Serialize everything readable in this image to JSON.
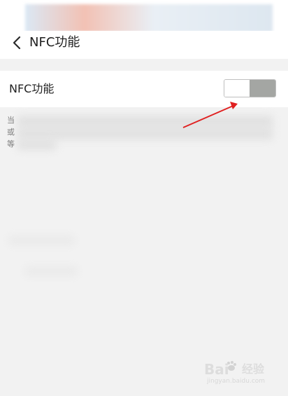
{
  "status": {
    "blurred": true,
    "gradient": [
      "#dbe8f4",
      "#f2c1b4",
      "#e9eff5",
      "#dde7f0"
    ]
  },
  "header": {
    "title": "NFC功能",
    "back_icon": "chevron-left-icon"
  },
  "setting": {
    "label": "NFC功能",
    "toggle_state": "on"
  },
  "description": {
    "lines": [
      "当",
      "或",
      "等"
    ]
  },
  "watermark": {
    "text_main": "Bai",
    "text_sub": "经验",
    "text_url": "jingyan.baidu.com"
  },
  "colors": {
    "background": "#f2f2f2",
    "toggle_track": "#a4a6a3",
    "annotation_arrow": "#e02020"
  }
}
